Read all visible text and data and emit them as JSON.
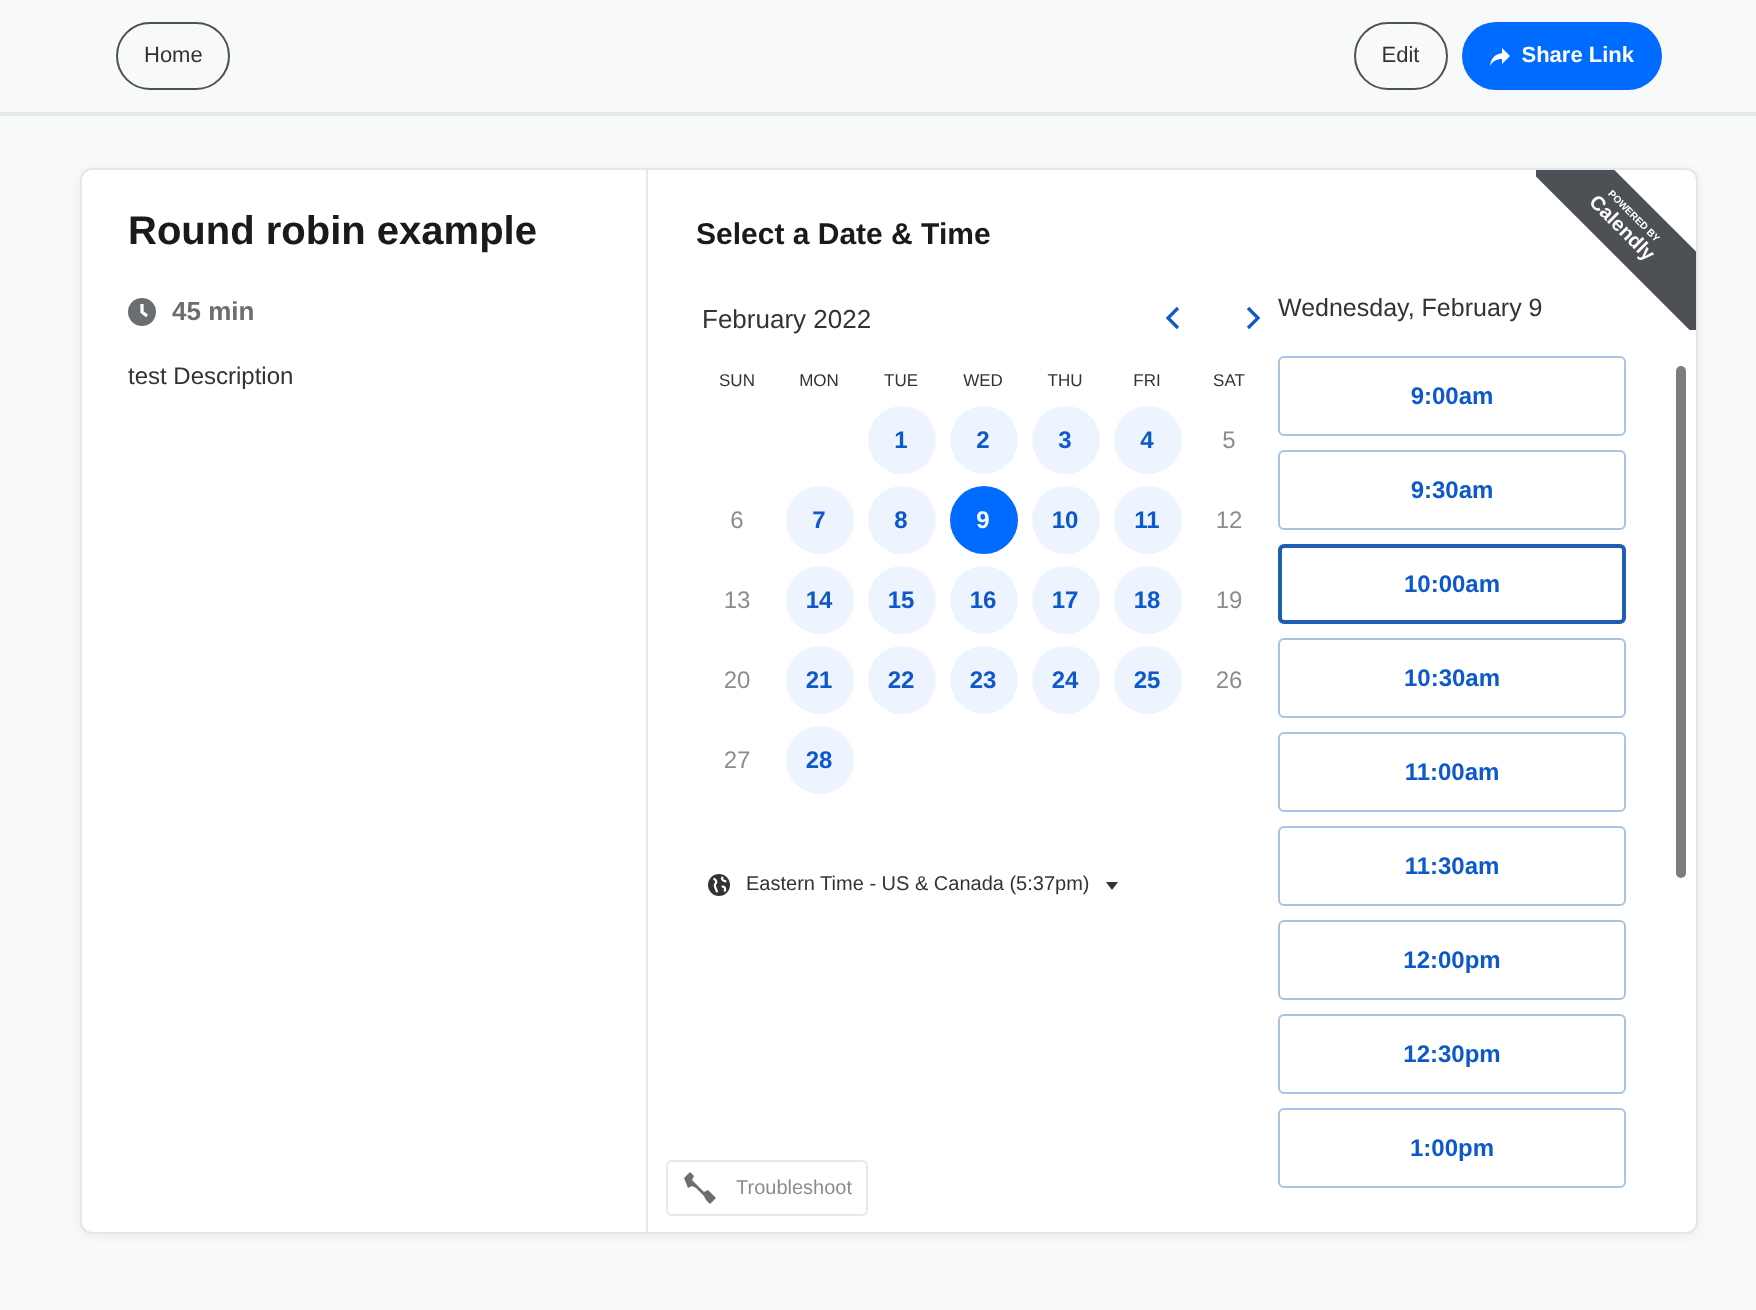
{
  "top_bar": {
    "home_button": "Home",
    "edit_button": "Edit",
    "share_button": "Share Link"
  },
  "event": {
    "title": "Round robin example",
    "duration": "45 min",
    "description": "test Description"
  },
  "scheduler": {
    "title": "Select a Date & Time",
    "month": "February 2022",
    "weekdays": [
      "SUN",
      "MON",
      "TUE",
      "WED",
      "THU",
      "FRI",
      "SAT"
    ],
    "weeks": [
      [
        {
          "label": "1",
          "available": true,
          "selected": false
        },
        {
          "label": "2",
          "available": true,
          "selected": false
        },
        {
          "label": "3",
          "available": true,
          "selected": false
        },
        {
          "label": "4",
          "available": true,
          "selected": false
        },
        {
          "label": "5",
          "available": false,
          "selected": false
        }
      ],
      [
        {
          "label": "6",
          "available": false,
          "selected": false
        },
        {
          "label": "7",
          "available": true,
          "selected": false
        },
        {
          "label": "8",
          "available": true,
          "selected": false
        },
        {
          "label": "9",
          "available": true,
          "selected": true
        },
        {
          "label": "10",
          "available": true,
          "selected": false
        },
        {
          "label": "11",
          "available": true,
          "selected": false
        },
        {
          "label": "12",
          "available": false,
          "selected": false
        }
      ],
      [
        {
          "label": "13",
          "available": false,
          "selected": false
        },
        {
          "label": "14",
          "available": true,
          "selected": false
        },
        {
          "label": "15",
          "available": true,
          "selected": false
        },
        {
          "label": "16",
          "available": true,
          "selected": false
        },
        {
          "label": "17",
          "available": true,
          "selected": false
        },
        {
          "label": "18",
          "available": true,
          "selected": false
        },
        {
          "label": "19",
          "available": false,
          "selected": false
        }
      ],
      [
        {
          "label": "20",
          "available": false,
          "selected": false
        },
        {
          "label": "21",
          "available": true,
          "selected": false
        },
        {
          "label": "22",
          "available": true,
          "selected": false
        },
        {
          "label": "23",
          "available": true,
          "selected": false
        },
        {
          "label": "24",
          "available": true,
          "selected": false
        },
        {
          "label": "25",
          "available": true,
          "selected": false
        },
        {
          "label": "26",
          "available": false,
          "selected": false
        }
      ],
      [
        {
          "label": "27",
          "available": false,
          "selected": false
        },
        {
          "label": "28",
          "available": true,
          "selected": false
        }
      ]
    ],
    "timezone": "Eastern Time - US & Canada (5:37pm)",
    "date_heading": "Wednesday, February 9",
    "slots": [
      {
        "label": "9:00am",
        "hovered": false
      },
      {
        "label": "9:30am",
        "hovered": false
      },
      {
        "label": "10:00am",
        "hovered": true
      },
      {
        "label": "10:30am",
        "hovered": false
      },
      {
        "label": "11:00am",
        "hovered": false
      },
      {
        "label": "11:30am",
        "hovered": false
      },
      {
        "label": "12:00pm",
        "hovered": false
      },
      {
        "label": "12:30pm",
        "hovered": false
      },
      {
        "label": "1:00pm",
        "hovered": false
      }
    ],
    "troubleshoot_button": "Troubleshoot"
  },
  "badge": {
    "line_1": "POWERED BY",
    "line_2": "Calendly"
  }
}
